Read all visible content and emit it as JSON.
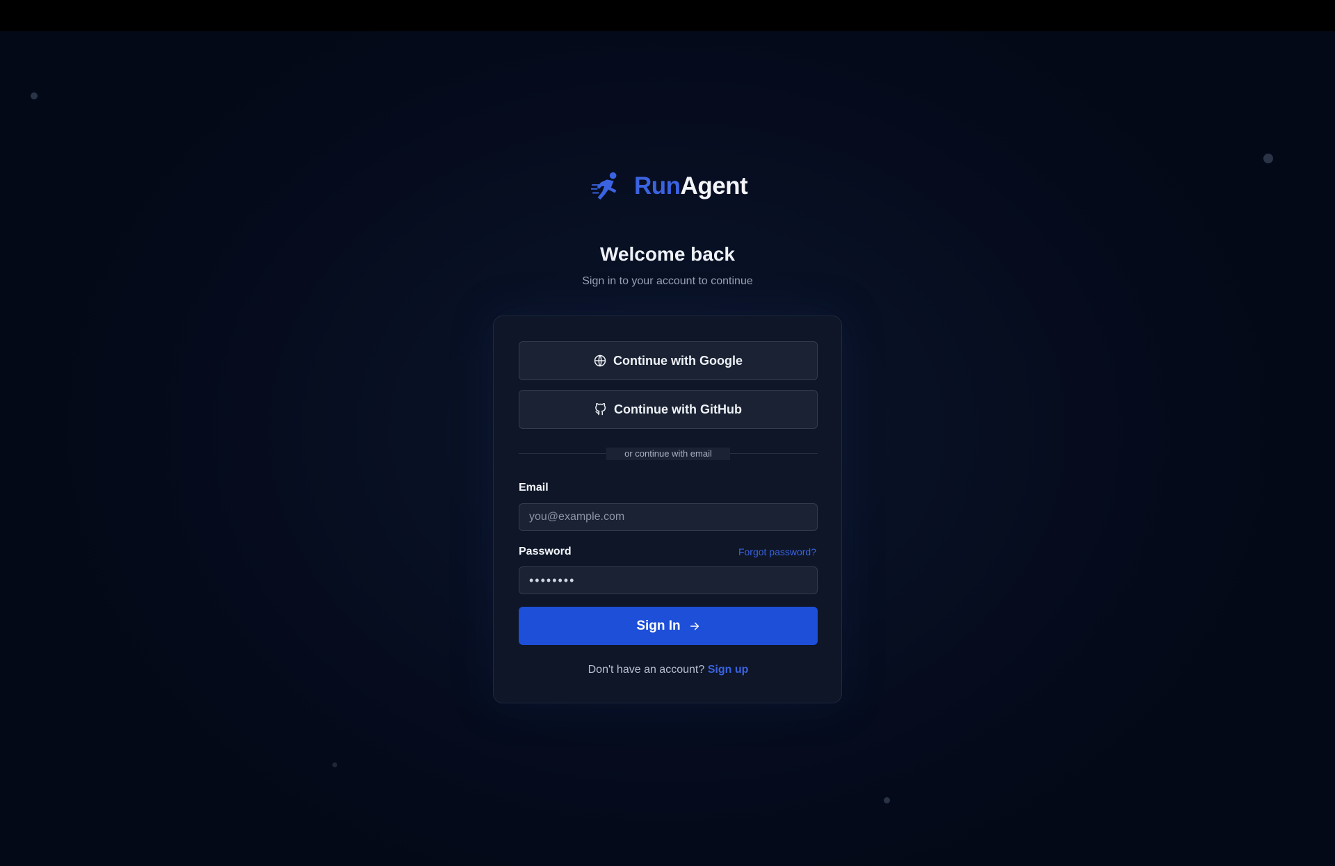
{
  "brand": {
    "name_part1": "Run",
    "name_part2": "Agent",
    "logo_icon": "running-figure-icon",
    "accent_color": "#3b63e0"
  },
  "page": {
    "heading": "Welcome back",
    "subheading": "Sign in to your account to continue"
  },
  "oauth": {
    "google_label": "Continue with Google",
    "google_icon": "globe-icon",
    "github_label": "Continue with GitHub",
    "github_icon": "github-icon"
  },
  "divider": {
    "label": "or continue with email"
  },
  "form": {
    "email_label": "Email",
    "email_placeholder": "you@example.com",
    "email_value": "",
    "password_label": "Password",
    "password_value": "password",
    "forgot_label": "Forgot password?",
    "submit_label": "Sign In",
    "submit_icon": "arrow-right-icon",
    "submit_color": "#1d4fd8"
  },
  "signup": {
    "prompt": "Don't have an account?",
    "link_label": "Sign up"
  }
}
